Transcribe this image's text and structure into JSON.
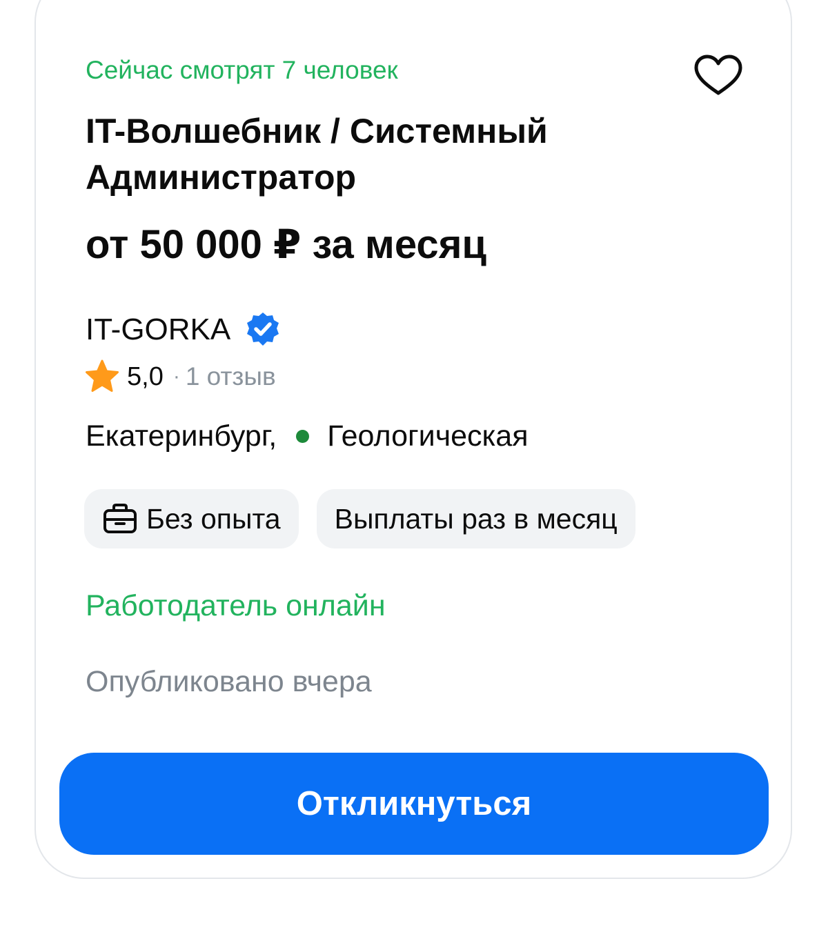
{
  "vacancy": {
    "viewers_text": "Сейчас смотрят 7 человек",
    "title": "IT-Волшебник / Системный Администратор",
    "salary": "от 50 000 ₽ за месяц",
    "company": {
      "name": "IT-GORKA",
      "verified": true
    },
    "rating": {
      "value": "5,0",
      "separator": "·",
      "reviews": "1 отзыв"
    },
    "location": {
      "city": "Екатеринбург,",
      "metro": "Геологическая"
    },
    "tags": [
      {
        "label": "Без опыта",
        "icon": "briefcase-icon"
      },
      {
        "label": "Выплаты раз в месяц"
      }
    ],
    "employer_status": "Работодатель онлайн",
    "published": "Опубликовано вчера",
    "apply_label": "Откликнуться"
  },
  "colors": {
    "accent_blue": "#0a70f5",
    "online_green": "#22b35e",
    "metro_green": "#1d8a3a",
    "star_orange": "#ff9a1a",
    "muted_gray": "#7d858e",
    "tag_bg": "#f1f3f5"
  },
  "icons": {
    "favorite": "heart-outline-icon",
    "verified": "verified-badge-icon",
    "rating": "star-icon",
    "metro": "metro-dot-icon"
  }
}
